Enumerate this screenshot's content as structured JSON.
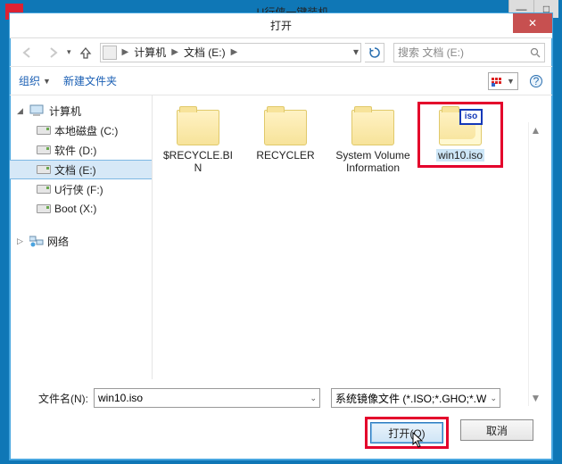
{
  "outer_window": {
    "title": "U行侠一键装机",
    "minimize": "—",
    "maximize": "□"
  },
  "dialog": {
    "title": "打开",
    "close": "✕"
  },
  "nav": {
    "breadcrumb": {
      "seg1": "计算机",
      "seg2": "文档 (E:)"
    },
    "search_placeholder": "搜索 文档 (E:)"
  },
  "toolbar": {
    "organize": "组织",
    "new_folder": "新建文件夹",
    "help": "?"
  },
  "sidebar": {
    "computer": "计算机",
    "drives": [
      {
        "label": "本地磁盘 (C:)"
      },
      {
        "label": "软件 (D:)"
      },
      {
        "label": "文档 (E:)"
      },
      {
        "label": "U行侠 (F:)"
      },
      {
        "label": "Boot (X:)"
      }
    ],
    "network": "网络"
  },
  "files": [
    {
      "name": "$RECYCLE.BIN",
      "type": "folder"
    },
    {
      "name": "RECYCLER",
      "type": "folder"
    },
    {
      "name": "System Volume Information",
      "type": "folder"
    },
    {
      "name": "win10.iso",
      "type": "iso",
      "selected": true,
      "badge": "iso"
    }
  ],
  "footer": {
    "filename_label": "文件名(N):",
    "filename_value": "win10.iso",
    "filter_value": "系统镜像文件 (*.ISO;*.GHO;*.W",
    "open": "打开(O)",
    "cancel": "取消"
  }
}
